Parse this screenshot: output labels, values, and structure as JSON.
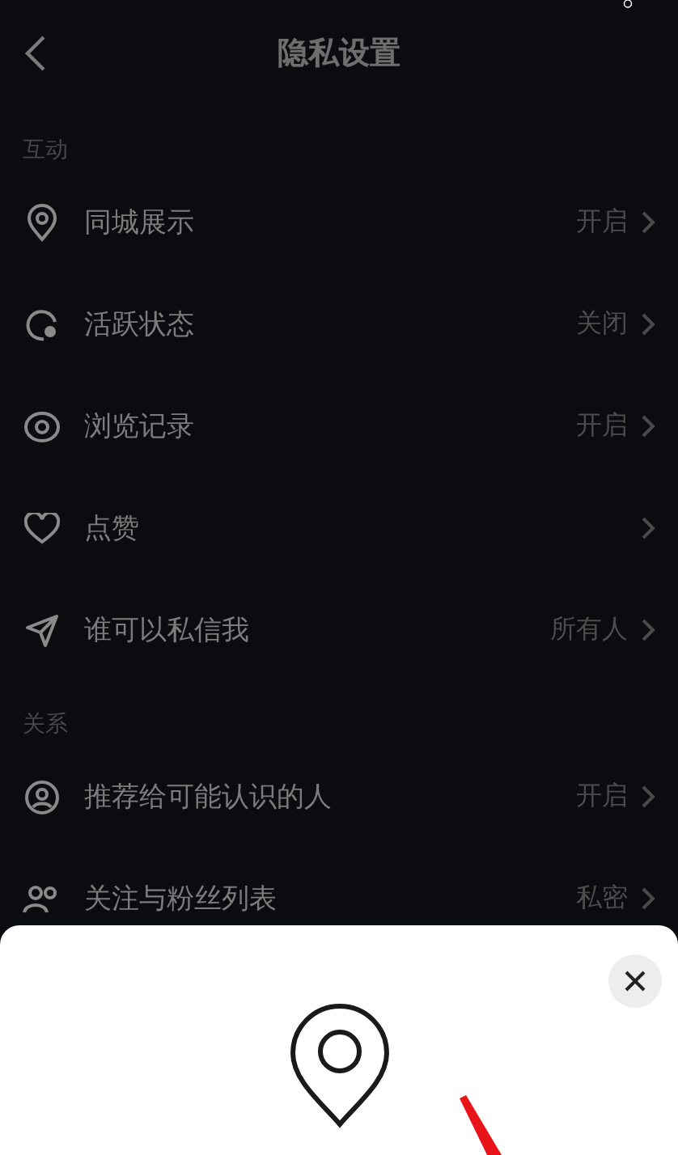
{
  "header": {
    "title": "隐私设置"
  },
  "sections": [
    {
      "label": "互动",
      "rows": [
        {
          "label": "同城展示",
          "value": "开启"
        },
        {
          "label": "活跃状态",
          "value": "关闭"
        },
        {
          "label": "浏览记录",
          "value": "开启"
        },
        {
          "label": "点赞"
        },
        {
          "label": "谁可以私信我",
          "value": "所有人"
        }
      ]
    },
    {
      "label": "关系",
      "rows": [
        {
          "label": "推荐给可能认识的人",
          "value": "开启"
        },
        {
          "label": "关注与粉丝列表",
          "value": "私密"
        }
      ]
    }
  ]
}
